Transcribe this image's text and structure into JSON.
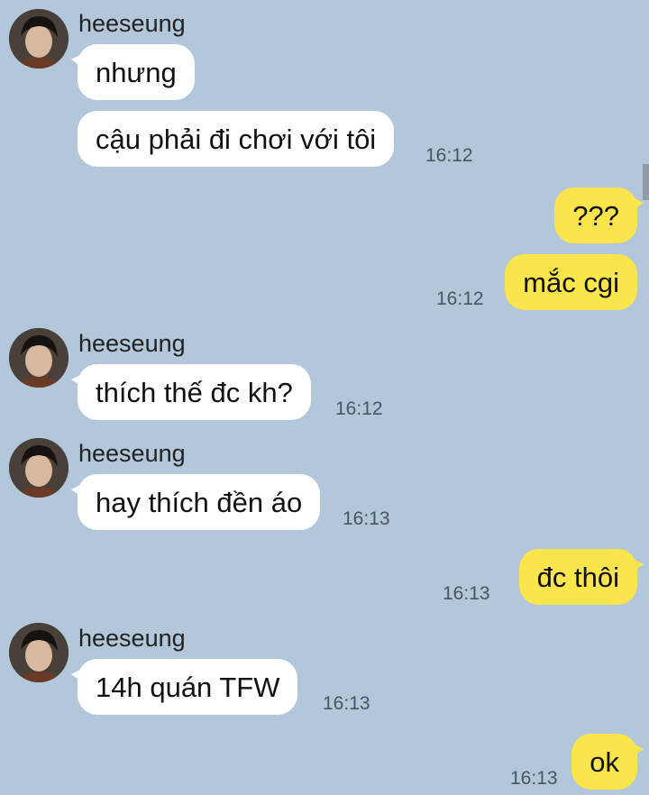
{
  "contact": {
    "name": "heeseung"
  },
  "messages": [
    {
      "sender": "heeseung",
      "text": "nhưng",
      "time": ""
    },
    {
      "sender": "heeseung",
      "text": "cậu phải đi chơi với tôi",
      "time": "16:12"
    },
    {
      "sender": "me",
      "text": "???",
      "time": ""
    },
    {
      "sender": "me",
      "text": "mắc cgi",
      "time": "16:12"
    },
    {
      "sender": "heeseung",
      "text": "thích thế đc kh?",
      "time": "16:12"
    },
    {
      "sender": "heeseung",
      "text": "hay thích đền áo",
      "time": "16:13"
    },
    {
      "sender": "me",
      "text": "đc thôi",
      "time": "16:13"
    },
    {
      "sender": "heeseung",
      "text": "14h quán TFW",
      "time": "16:13"
    },
    {
      "sender": "me",
      "text": "ok",
      "time": "16:13"
    }
  ],
  "colors": {
    "background": "#b2c7da",
    "incoming_bubble": "#ffffff",
    "outgoing_bubble": "#fae54d"
  }
}
